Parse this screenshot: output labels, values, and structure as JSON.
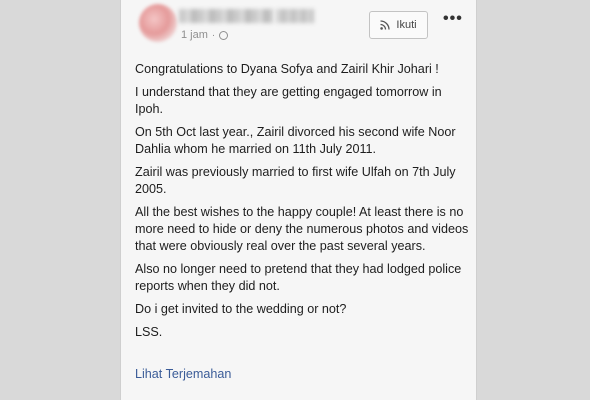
{
  "post": {
    "time": "1 jam",
    "separator": "·",
    "follow_label": "Ikuti",
    "more_icon": "more-horizontal-icon",
    "paragraphs": [
      "Congratulations to Dyana Sofya and Zairil Khir Johari !",
      "I understand that they are getting engaged tomorrow in Ipoh.",
      "On 5th Oct last year., Zairil divorced his second wife Noor Dahlia whom he married on 11th July 2011.",
      "Zairil was previously married to first wife Ulfah on 7th July 2005.",
      "All the best wishes to the happy couple! At least there is no more need to hide or deny the numerous photos and videos that were obviously real over the past several years.",
      "Also no longer need to pretend that they had lodged police reports when they did not.",
      "Do i get invited to the wedding or not?",
      "LSS."
    ],
    "translate_link": "Lihat Terjemahan"
  }
}
